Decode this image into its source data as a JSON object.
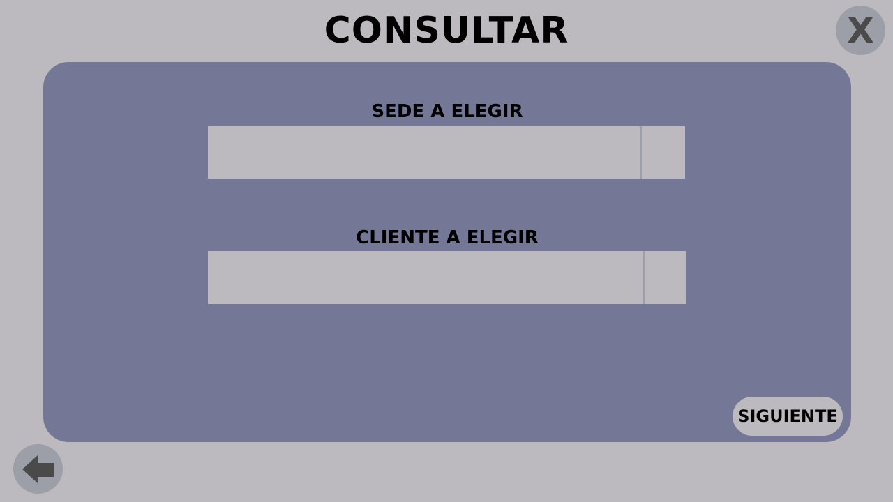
{
  "header": {
    "title": "CONSULTAR",
    "close_label": "X"
  },
  "form": {
    "sede": {
      "label": "SEDE A ELEGIR",
      "value": ""
    },
    "cliente": {
      "label": "CLIENTE A ELEGIR",
      "value": ""
    },
    "next_label": "SIGUIENTE"
  },
  "footer": {
    "back_icon": "arrow-left-icon"
  },
  "colors": {
    "background": "#bcbabe",
    "panel": "#747896",
    "circle_button": "#9c9ea8",
    "icon": "#4a4a4a",
    "text": "#000000"
  }
}
